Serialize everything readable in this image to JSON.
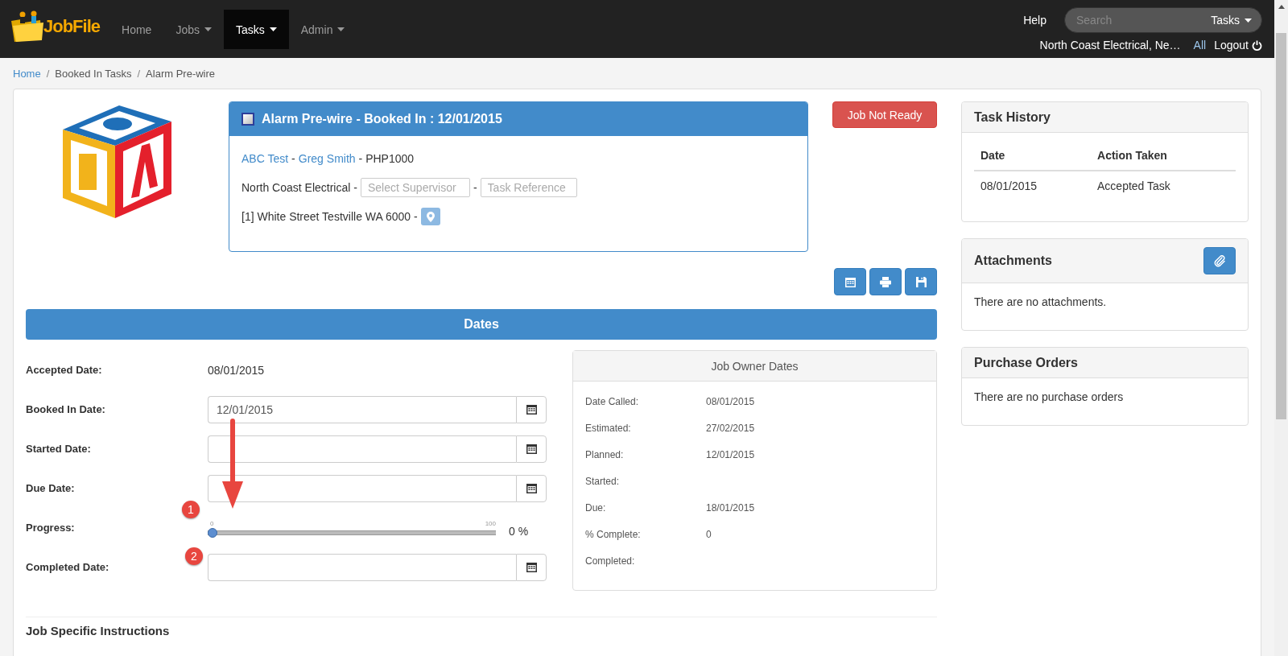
{
  "navbar": {
    "brand": "JobFile",
    "menu": [
      {
        "label": "Home",
        "dropdown": false,
        "selected": false
      },
      {
        "label": "Jobs",
        "dropdown": true,
        "selected": false
      },
      {
        "label": "Tasks",
        "dropdown": true,
        "selected": true
      },
      {
        "label": "Admin",
        "dropdown": true,
        "selected": false
      }
    ],
    "help": "Help",
    "search": {
      "placeholder": "Search",
      "scope": "Tasks"
    },
    "company": "North Coast Electrical, Ne…",
    "all": "All",
    "logout": "Logout"
  },
  "breadcrumb": [
    {
      "kind": "link",
      "text": "Home"
    },
    {
      "kind": "separator",
      "text": "/"
    },
    {
      "kind": "text",
      "text": "Booked In Tasks"
    },
    {
      "kind": "separator",
      "text": "/"
    },
    {
      "kind": "text",
      "text": "Alarm Pre-wire"
    }
  ],
  "task_panel": {
    "title": "Alarm Pre-wire - Booked In : 12/01/2015",
    "line_1": [
      {
        "kind": "link",
        "text": "ABC Test"
      },
      {
        "kind": "text",
        "text": "-"
      },
      {
        "kind": "link",
        "text": "Greg Smith"
      },
      {
        "kind": "text",
        "text": "- PHP1000"
      }
    ],
    "line_2": [
      {
        "kind": "text",
        "text": "North Coast Electrical -"
      },
      {
        "kind": "field",
        "placeholder": "Select Supervisor"
      },
      {
        "kind": "text",
        "text": "-"
      },
      {
        "kind": "field",
        "placeholder": "Task Reference"
      }
    ],
    "line_3": [
      {
        "kind": "text",
        "text": "[1] White Street Testville WA 6000 -"
      },
      {
        "kind": "map"
      }
    ]
  },
  "status_button": "Job Not Ready",
  "dates": {
    "title": "Dates",
    "rows": [
      {
        "kind": "text",
        "label": "Accepted Date:",
        "value": "08/01/2015"
      },
      {
        "kind": "date",
        "label": "Booked In Date:",
        "value": "12/01/2015"
      },
      {
        "kind": "date",
        "label": "Started Date:"
      },
      {
        "kind": "date",
        "label": "Due Date:"
      },
      {
        "kind": "slider",
        "label": "Progress:",
        "min": "0",
        "max": "100",
        "level": 0,
        "reading": "0 %"
      },
      {
        "kind": "date",
        "label": "Completed Date:"
      }
    ]
  },
  "job_owner_dates": {
    "title": "Job Owner Dates",
    "rows": [
      {
        "label": "Date Called:",
        "value": "08/01/2015"
      },
      {
        "label": "Estimated:",
        "value": "27/02/2015"
      },
      {
        "label": "Planned:",
        "value": "12/01/2015"
      },
      {
        "label": "Started:"
      },
      {
        "label": "Due:",
        "value": "18/01/2015"
      },
      {
        "label": "% Complete:",
        "value": "0"
      },
      {
        "label": "Completed:"
      }
    ]
  },
  "section_heading": "Job Specific Instructions",
  "task_history": {
    "title": "Task History",
    "columns": [
      "Date",
      "Action Taken"
    ],
    "rows": [
      [
        "08/01/2015",
        "Accepted Task"
      ]
    ]
  },
  "attachments": {
    "title": "Attachments",
    "empty": "There are no attachments."
  },
  "purchase_orders": {
    "title": "Purchase Orders",
    "empty": "There are no purchase orders"
  },
  "annotations": [
    {
      "label": "1"
    },
    {
      "label": "2"
    }
  ]
}
